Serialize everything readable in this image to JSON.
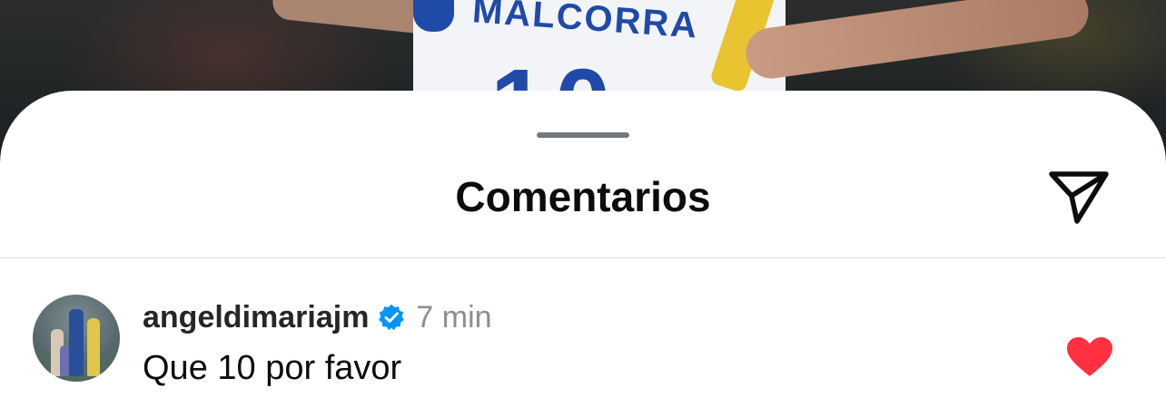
{
  "background": {
    "jersey_name": "MALCORRA",
    "jersey_number": "10"
  },
  "sheet": {
    "title": "Comentarios",
    "share_icon": "paper-plane-icon"
  },
  "comments": [
    {
      "username": "angeldimariajm",
      "verified": true,
      "time": "7 min",
      "text": "Que 10 por favor",
      "liked": true
    }
  ],
  "colors": {
    "like": "#ff3040",
    "verified": "#0095f6",
    "secondary_text": "#8e8e8e"
  }
}
